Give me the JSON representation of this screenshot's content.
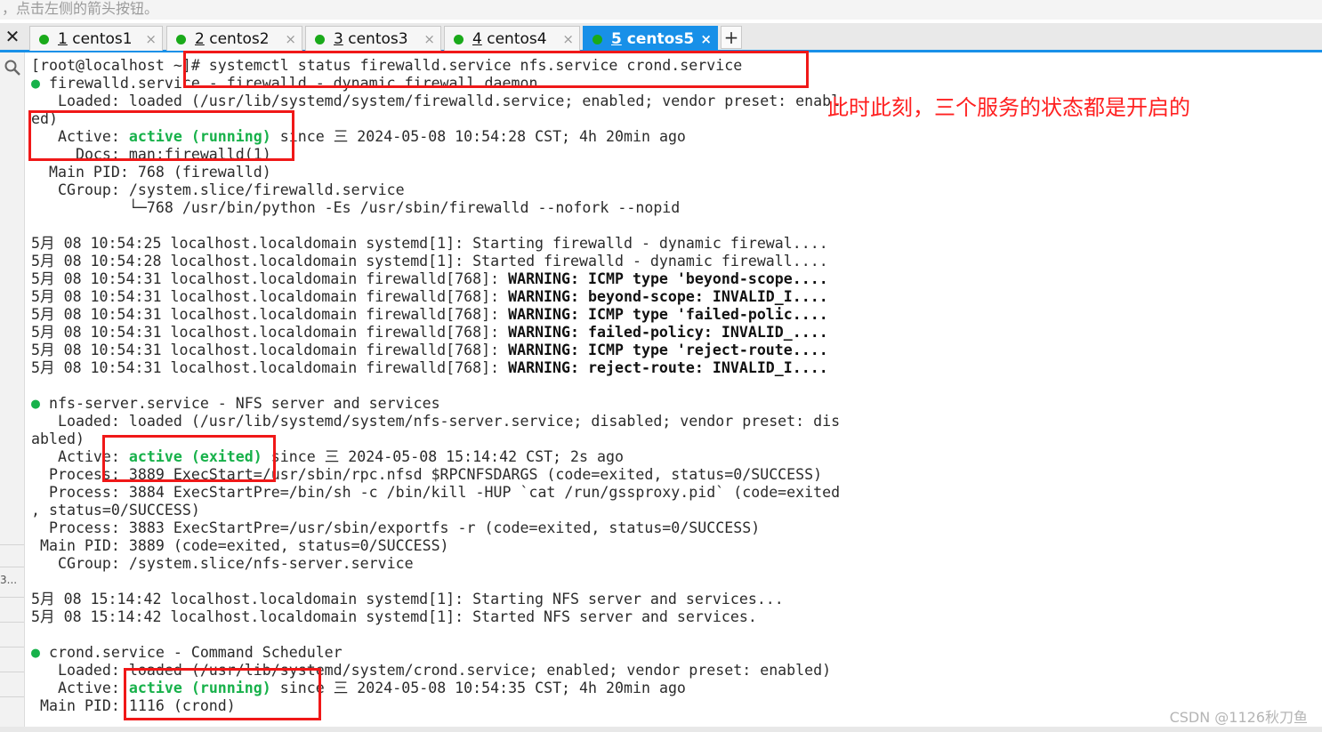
{
  "hint_text": "，点击左侧的箭头按钮。",
  "tabs": [
    {
      "num": "1",
      "name": "centos1",
      "active": false
    },
    {
      "num": "2",
      "name": "centos2",
      "active": false
    },
    {
      "num": "3",
      "name": "centos3",
      "active": false
    },
    {
      "num": "4",
      "name": "centos4",
      "active": false
    },
    {
      "num": "5",
      "name": "centos5",
      "active": true
    }
  ],
  "tab_close_glyph": "×",
  "add_tab_label": "+",
  "left_pane": {
    "ellipsis": "3..."
  },
  "terminal": {
    "lines": [
      [
        {
          "t": "[root@localhost ~]# systemctl status firewalld.service nfs.service crond.service"
        }
      ],
      [
        {
          "t": "● ",
          "c": "bullet"
        },
        {
          "t": "firewalld.service - firewalld - dynamic firewall daemon"
        }
      ],
      [
        {
          "t": "   Loaded: loaded (/usr/lib/systemd/system/firewalld.service; enabled; vendor preset: enabl"
        }
      ],
      [
        {
          "t": "ed)"
        }
      ],
      [
        {
          "t": "   Active: "
        },
        {
          "t": "active (running)",
          "c": "g"
        },
        {
          "t": " since 三 2024-05-08 10:54:28 CST; 4h 20min ago"
        }
      ],
      [
        {
          "t": "     Docs: man:firewalld(1)"
        }
      ],
      [
        {
          "t": "  Main PID: 768 (firewalld)"
        }
      ],
      [
        {
          "t": "   CGroup: /system.slice/firewalld.service"
        }
      ],
      [
        {
          "t": "           └─768 /usr/bin/python -Es /usr/sbin/firewalld --nofork --nopid"
        }
      ],
      [
        {
          "t": ""
        }
      ],
      [
        {
          "t": "5月 08 10:54:25 localhost.localdomain systemd[1]: Starting firewalld - dynamic firewal...."
        }
      ],
      [
        {
          "t": "5月 08 10:54:28 localhost.localdomain systemd[1]: Started firewalld - dynamic firewall...."
        }
      ],
      [
        {
          "t": "5月 08 10:54:31 localhost.localdomain firewalld[768]: "
        },
        {
          "t": "WARNING: ICMP type 'beyond-scope....",
          "c": "b"
        }
      ],
      [
        {
          "t": "5月 08 10:54:31 localhost.localdomain firewalld[768]: "
        },
        {
          "t": "WARNING: beyond-scope: INVALID_I....",
          "c": "b"
        }
      ],
      [
        {
          "t": "5月 08 10:54:31 localhost.localdomain firewalld[768]: "
        },
        {
          "t": "WARNING: ICMP type 'failed-polic....",
          "c": "b"
        }
      ],
      [
        {
          "t": "5月 08 10:54:31 localhost.localdomain firewalld[768]: "
        },
        {
          "t": "WARNING: failed-policy: INVALID_....",
          "c": "b"
        }
      ],
      [
        {
          "t": "5月 08 10:54:31 localhost.localdomain firewalld[768]: "
        },
        {
          "t": "WARNING: ICMP type 'reject-route....",
          "c": "b"
        }
      ],
      [
        {
          "t": "5月 08 10:54:31 localhost.localdomain firewalld[768]: "
        },
        {
          "t": "WARNING: reject-route: INVALID_I....",
          "c": "b"
        }
      ],
      [
        {
          "t": ""
        }
      ],
      [
        {
          "t": "● ",
          "c": "bullet"
        },
        {
          "t": "nfs-server.service - NFS server and services"
        }
      ],
      [
        {
          "t": "   Loaded: loaded (/usr/lib/systemd/system/nfs-server.service; disabled; vendor preset: dis"
        }
      ],
      [
        {
          "t": "abled)"
        }
      ],
      [
        {
          "t": "   Active: "
        },
        {
          "t": "active (exited)",
          "c": "g"
        },
        {
          "t": " since 三 2024-05-08 15:14:42 CST; 2s ago"
        }
      ],
      [
        {
          "t": "  Process: 3889 ExecStart=/usr/sbin/rpc.nfsd $RPCNFSDARGS (code=exited, status=0/SUCCESS)"
        }
      ],
      [
        {
          "t": "  Process: 3884 ExecStartPre=/bin/sh -c /bin/kill -HUP `cat /run/gssproxy.pid` (code=exited"
        }
      ],
      [
        {
          "t": ", status=0/SUCCESS)"
        }
      ],
      [
        {
          "t": "  Process: 3883 ExecStartPre=/usr/sbin/exportfs -r (code=exited, status=0/SUCCESS)"
        }
      ],
      [
        {
          "t": " Main PID: 3889 (code=exited, status=0/SUCCESS)"
        }
      ],
      [
        {
          "t": "   CGroup: /system.slice/nfs-server.service"
        }
      ],
      [
        {
          "t": ""
        }
      ],
      [
        {
          "t": "5月 08 15:14:42 localhost.localdomain systemd[1]: Starting NFS server and services..."
        }
      ],
      [
        {
          "t": "5月 08 15:14:42 localhost.localdomain systemd[1]: Started NFS server and services."
        }
      ],
      [
        {
          "t": ""
        }
      ],
      [
        {
          "t": "● ",
          "c": "bullet"
        },
        {
          "t": "crond.service - Command Scheduler"
        }
      ],
      [
        {
          "t": "   Loaded: loaded (/usr/lib/systemd/system/crond.service; enabled; vendor preset: enabled)"
        }
      ],
      [
        {
          "t": "   Active: "
        },
        {
          "t": "active (running)",
          "c": "g"
        },
        {
          "t": " since 三 2024-05-08 10:54:35 CST; 4h 20min ago"
        }
      ],
      [
        {
          "t": " Main PID: 1116 (crond)"
        }
      ]
    ]
  },
  "annotation": "此时此刻，三个服务的状态都是开启的",
  "watermark": "CSDN @1126秋刀鱼",
  "colors": {
    "accent": "#1890e8",
    "active_green": "#17b14a",
    "annotation_red": "#f01818"
  }
}
